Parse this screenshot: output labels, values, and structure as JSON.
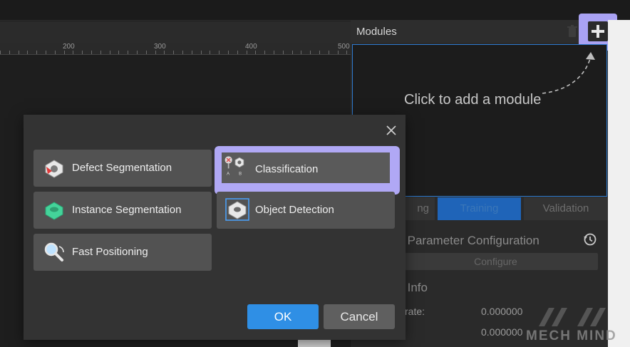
{
  "ruler": {
    "labels": [
      "200",
      "300",
      "400",
      "500"
    ]
  },
  "modules": {
    "title": "Modules",
    "hint": "Click to add a module",
    "tabs": [
      "Training",
      "Validation"
    ],
    "partial_tab_text": "ng",
    "param_title": "ng Parameter Configuration",
    "configure_label": "Configure",
    "info_title": "ng Info",
    "rate_label": "rate:",
    "values": [
      "0.000000",
      "0.000000"
    ]
  },
  "dialog": {
    "options": [
      {
        "label": "Defect Segmentation",
        "icon": "defect-segmentation-icon"
      },
      {
        "label": "Classification",
        "icon": "classification-icon",
        "selected": true
      },
      {
        "label": "Instance Segmentation",
        "icon": "instance-segmentation-icon"
      },
      {
        "label": "Object Detection",
        "icon": "object-detection-icon"
      },
      {
        "label": "Fast Positioning",
        "icon": "fast-positioning-icon"
      }
    ],
    "ok_label": "OK",
    "cancel_label": "Cancel"
  },
  "logo_text": "MECH MIND",
  "colors": {
    "accent": "#2f8fe5",
    "highlight": "#b0a8f5",
    "selection_border": "#2e7bd1"
  }
}
